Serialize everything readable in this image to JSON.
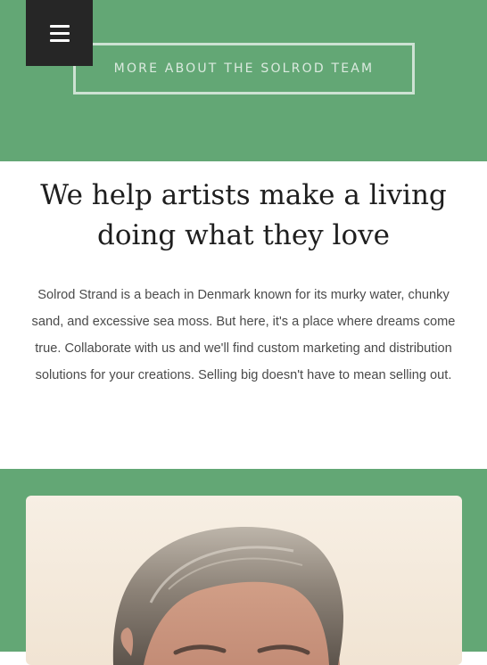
{
  "nav": {
    "menu_icon": "hamburger-menu-icon"
  },
  "hero": {
    "cta_label": "MORE ABOUT THE SOLROD TEAM"
  },
  "intro": {
    "headline": "We help artists make a living doing what they love",
    "body": "Solrod Strand is a beach in Denmark known for its murky water, chunky sand, and excessive sea moss. But here, it's a place where dreams come true. Collaborate with us and we'll find custom marketing and distribution solutions for your creations. Selling big doesn't have to mean selling out."
  },
  "colors": {
    "accent_green": "#63a775",
    "menu_dark": "#262626",
    "headline": "#1e1e1e",
    "body_text": "#4a4a4a"
  }
}
